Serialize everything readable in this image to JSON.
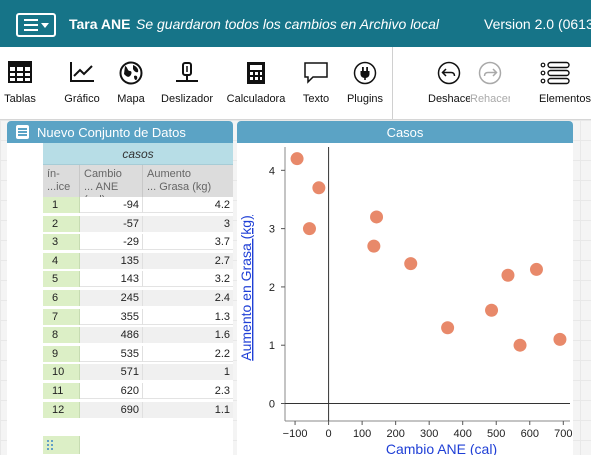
{
  "titlebar": {
    "doc_name": "Tara ANE",
    "save_status": "Se guardaron todos los cambios en Archivo local",
    "version": "Version 2.0 (0613"
  },
  "toolbar": {
    "tools": [
      {
        "id": "tables",
        "label": "Tablas",
        "icon": "table-grid-icon"
      },
      {
        "id": "graph",
        "label": "Gráfico",
        "icon": "graph-icon"
      },
      {
        "id": "map",
        "label": "Mapa",
        "icon": "globe-icon"
      },
      {
        "id": "slider",
        "label": "Deslizador",
        "icon": "slider-icon"
      },
      {
        "id": "calculator",
        "label": "Calculadora",
        "icon": "calculator-icon"
      },
      {
        "id": "text",
        "label": "Texto",
        "icon": "speech-bubble-icon"
      },
      {
        "id": "plugins",
        "label": "Plugins",
        "icon": "plug-icon"
      }
    ],
    "undo_label": "Deshace",
    "redo_label": "Rehacer",
    "elements_label": "Elementos"
  },
  "table": {
    "title": "Nuevo Conjunto de Datos",
    "collection": "casos",
    "columns": [
      {
        "key": "index",
        "label_line1": "ín-",
        "label_line2": "...ice"
      },
      {
        "key": "cambio",
        "label_line1": "Cambio",
        "label_line2": "... ANE (cal)"
      },
      {
        "key": "aumento",
        "label_line1": "Aumento",
        "label_line2": "... Grasa (kg)"
      }
    ],
    "rows": [
      {
        "index": "1",
        "cambio": "-94",
        "aumento": "4.2"
      },
      {
        "index": "2",
        "cambio": "-57",
        "aumento": "3"
      },
      {
        "index": "3",
        "cambio": "-29",
        "aumento": "3.7"
      },
      {
        "index": "4",
        "cambio": "135",
        "aumento": "2.7"
      },
      {
        "index": "5",
        "cambio": "143",
        "aumento": "3.2"
      },
      {
        "index": "6",
        "cambio": "245",
        "aumento": "2.4"
      },
      {
        "index": "7",
        "cambio": "355",
        "aumento": "1.3"
      },
      {
        "index": "8",
        "cambio": "486",
        "aumento": "1.6"
      },
      {
        "index": "9",
        "cambio": "535",
        "aumento": "2.2"
      },
      {
        "index": "10",
        "cambio": "571",
        "aumento": "1"
      },
      {
        "index": "11",
        "cambio": "620",
        "aumento": "2.3"
      },
      {
        "index": "12",
        "cambio": "690",
        "aumento": "1.1"
      }
    ]
  },
  "graph": {
    "title": "Casos"
  },
  "colors": {
    "titlebar": "#167488",
    "tile_header": "#5ba3c5",
    "point": "#e8896a",
    "link": "#1f3fd6",
    "index_column": "#dcefc6"
  },
  "chart_data": {
    "type": "scatter",
    "title": "Casos",
    "xlabel": "Cambio ANE (cal)",
    "ylabel": "Aumento en Grasa (kg)",
    "xlim": [
      -130,
      720
    ],
    "ylim": [
      -0.3,
      4.4
    ],
    "xticks": [
      -100,
      0,
      100,
      200,
      300,
      400,
      500,
      600,
      700
    ],
    "yticks": [
      0,
      1,
      2,
      3,
      4
    ],
    "grid": false,
    "points": [
      {
        "x": -94,
        "y": 4.2
      },
      {
        "x": -57,
        "y": 3
      },
      {
        "x": -29,
        "y": 3.7
      },
      {
        "x": 135,
        "y": 2.7
      },
      {
        "x": 143,
        "y": 3.2
      },
      {
        "x": 245,
        "y": 2.4
      },
      {
        "x": 355,
        "y": 1.3
      },
      {
        "x": 486,
        "y": 1.6
      },
      {
        "x": 535,
        "y": 2.2
      },
      {
        "x": 571,
        "y": 1
      },
      {
        "x": 620,
        "y": 2.3
      },
      {
        "x": 690,
        "y": 1.1
      }
    ]
  }
}
